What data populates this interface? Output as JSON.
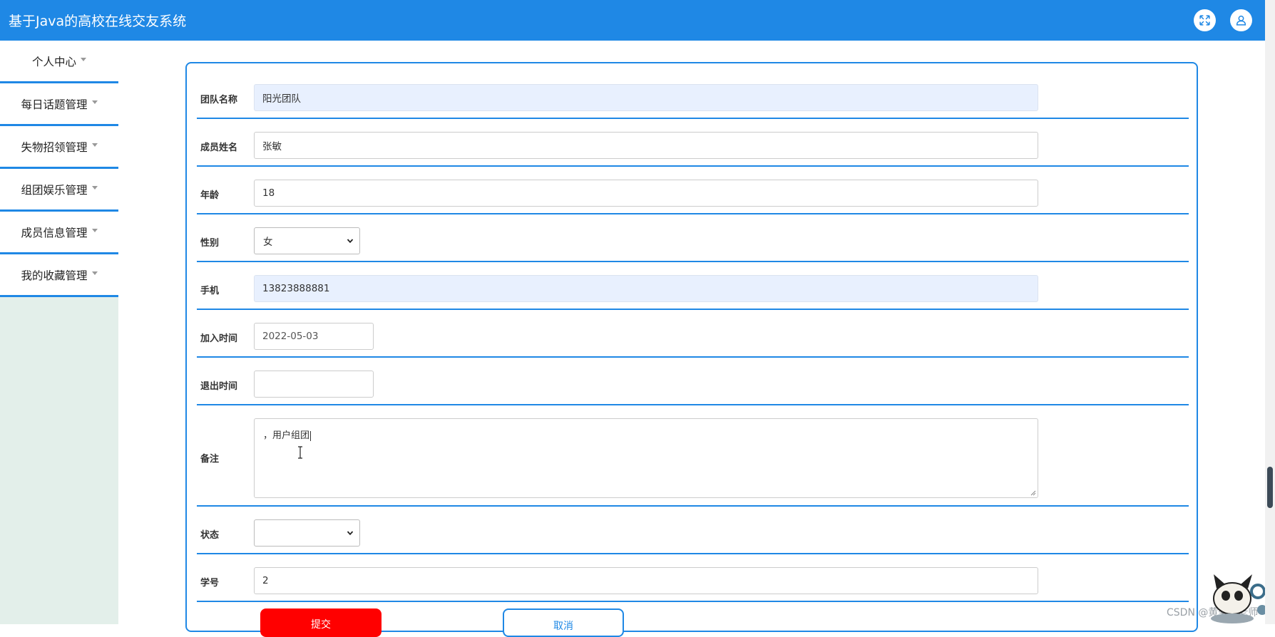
{
  "header": {
    "app_title": "基于Java的高校在线交友系统",
    "fullscreen_icon": "fullscreen-icon",
    "user_icon": "user-icon"
  },
  "sidebar": {
    "items": [
      {
        "label": "个人中心"
      },
      {
        "label": "每日话题管理"
      },
      {
        "label": "失物招领管理"
      },
      {
        "label": "组团娱乐管理"
      },
      {
        "label": "成员信息管理"
      },
      {
        "label": "我的收藏管理"
      }
    ]
  },
  "form": {
    "team_name": {
      "label": "团队名称",
      "value": "阳光团队"
    },
    "member_name": {
      "label": "成员姓名",
      "value": "张敏"
    },
    "age": {
      "label": "年龄",
      "value": "18"
    },
    "gender": {
      "label": "性别",
      "value": "女"
    },
    "phone": {
      "label": "手机",
      "value": "13823888881"
    },
    "join_time": {
      "label": "加入时间",
      "value": "2022-05-03"
    },
    "exit_time": {
      "label": "退出时间",
      "value": ""
    },
    "remarks": {
      "label": "备注",
      "value": "，用户组团"
    },
    "status": {
      "label": "状态",
      "value": ""
    },
    "student_id": {
      "label": "学号",
      "value": "2"
    }
  },
  "buttons": {
    "submit": "提交",
    "cancel": "取消"
  },
  "watermark": "CSDN @黄菊华老师",
  "colors": {
    "primary": "#1f88e5",
    "submit": "#ff0000",
    "sidebar_bg": "#e3efea",
    "autofill_bg": "#e8f0fe"
  }
}
